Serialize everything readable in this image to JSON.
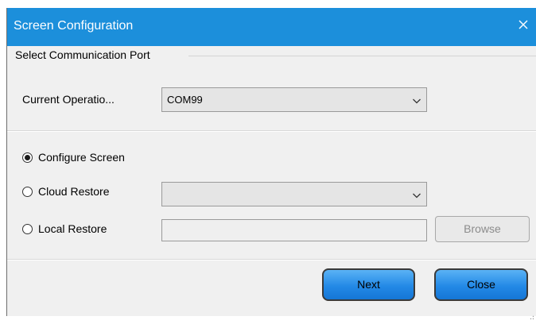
{
  "window": {
    "title": "Screen Configuration"
  },
  "port_group": {
    "label": "Select Communication Port",
    "current_operation_label": "Current Operatio...",
    "current_operation_value": "COM99"
  },
  "options": {
    "configure_screen": "Configure Screen",
    "cloud_restore": "Cloud Restore",
    "cloud_restore_value": "",
    "local_restore": "Local Restore",
    "local_restore_path": "",
    "browse_label": "Browse",
    "selected": "configure_screen"
  },
  "footer": {
    "next_label": "Next",
    "close_label": "Close"
  },
  "colors": {
    "titlebar": "#1c8fdb",
    "button_blue": "#2389e6"
  }
}
